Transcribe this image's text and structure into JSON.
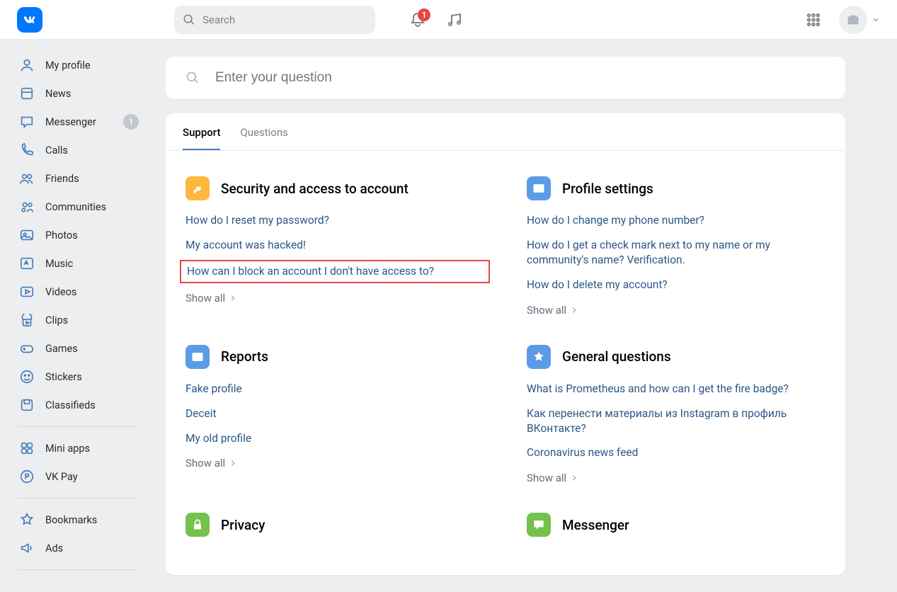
{
  "header": {
    "search_placeholder": "Search",
    "notification_count": "1"
  },
  "sidebar": {
    "items": [
      {
        "label": "My profile",
        "icon": "profile"
      },
      {
        "label": "News",
        "icon": "news"
      },
      {
        "label": "Messenger",
        "icon": "messenger",
        "badge": "1"
      },
      {
        "label": "Calls",
        "icon": "calls"
      },
      {
        "label": "Friends",
        "icon": "friends"
      },
      {
        "label": "Communities",
        "icon": "communities"
      },
      {
        "label": "Photos",
        "icon": "photos"
      },
      {
        "label": "Music",
        "icon": "music"
      },
      {
        "label": "Videos",
        "icon": "videos"
      },
      {
        "label": "Clips",
        "icon": "clips"
      },
      {
        "label": "Games",
        "icon": "games"
      },
      {
        "label": "Stickers",
        "icon": "stickers"
      },
      {
        "label": "Classifieds",
        "icon": "classifieds"
      }
    ],
    "group2": [
      {
        "label": "Mini apps",
        "icon": "miniapps"
      },
      {
        "label": "VK Pay",
        "icon": "vkpay"
      }
    ],
    "group3": [
      {
        "label": "Bookmarks",
        "icon": "bookmarks"
      },
      {
        "label": "Ads",
        "icon": "ads"
      }
    ]
  },
  "ask": {
    "placeholder": "Enter your question"
  },
  "tabs": {
    "support": "Support",
    "questions": "Questions"
  },
  "show_all_label": "Show all",
  "sections": [
    {
      "title": "Security and access to account",
      "color": "orange",
      "icon": "key",
      "links": [
        "How do I reset my password?",
        "My account was hacked!",
        "How can I block an account I don't have access to?"
      ],
      "highlight_index": 2
    },
    {
      "title": "Profile settings",
      "color": "blue",
      "icon": "profile-card",
      "links": [
        "How do I change my phone number?",
        "How do I get a check mark next to my name or my community's name? Verification.",
        "How do I delete my account?"
      ]
    },
    {
      "title": "Reports",
      "color": "blue",
      "icon": "report",
      "links": [
        "Fake profile",
        "Deceit",
        "My old profile"
      ]
    },
    {
      "title": "General questions",
      "color": "blue",
      "icon": "star",
      "links": [
        "What is Prometheus and how can I get the fire badge?",
        "Как перенести материалы из Instagram в профиль ВКонтакте?",
        "Coronavirus news feed"
      ]
    },
    {
      "title": "Privacy",
      "color": "green",
      "icon": "lock",
      "links": []
    },
    {
      "title": "Messenger",
      "color": "green",
      "icon": "chat",
      "links": []
    }
  ]
}
